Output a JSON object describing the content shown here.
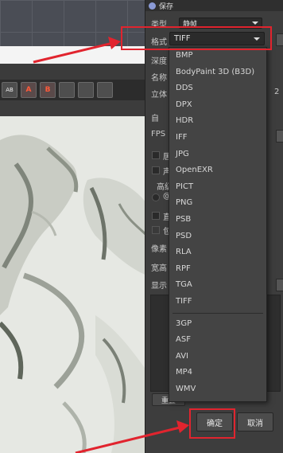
{
  "toolbar": {
    "btn_ab": "AB",
    "btn_a": "A",
    "btn_b": "B"
  },
  "settings": {
    "title": "保存",
    "type_label": "类型",
    "type_value": "静帧",
    "format_label": "格式",
    "format_value": "TIFF",
    "depth_label": "深度",
    "name_label": "名称",
    "stereo_label": "立体",
    "stereo_suffix": "2",
    "auto_label": "自",
    "fps_label": "FPS",
    "row_a": "居",
    "row_b": "声",
    "advanced_label": "高级",
    "row_c": "@",
    "row_d": "直",
    "row_e": "包",
    "pixel_label": "像素",
    "width_height_label": "宽高",
    "display_label": "显示",
    "reset_label": "重置",
    "ok_label": "确定",
    "cancel_label": "取消"
  },
  "dropdown": {
    "image_formats": [
      "BMP",
      "BodyPaint 3D (B3D)",
      "DDS",
      "DPX",
      "HDR",
      "IFF",
      "JPG",
      "OpenEXR",
      "PICT",
      "PNG",
      "PSB",
      "PSD",
      "RLA",
      "RPF",
      "TGA",
      "TIFF"
    ],
    "video_formats": [
      "3GP",
      "ASF",
      "AVI",
      "MP4",
      "WMV"
    ]
  },
  "colors": {
    "annotation": "#e1242e",
    "panel": "#3d3d3d",
    "dropdown": "#444444"
  }
}
